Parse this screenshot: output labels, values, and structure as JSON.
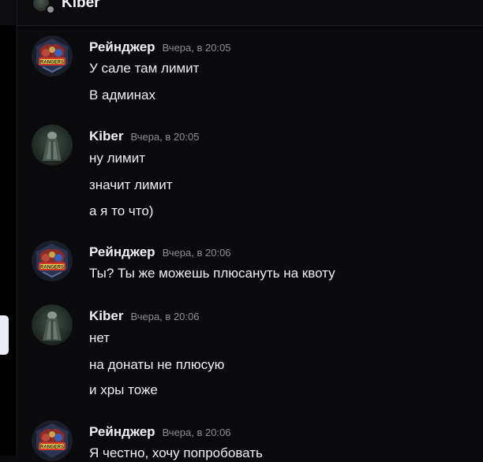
{
  "header": {
    "title": "Kiber",
    "avatar_icon": "user-avatar-icon",
    "status_icon": "status-dot-icon"
  },
  "colors": {
    "background": "#0a0a0c",
    "text": "#eef0f3",
    "timestamp": "#8b8e95",
    "side_pill": "#e9edf3"
  },
  "messages": [
    {
      "author": "Рейнджер",
      "timestamp": "Вчера, в 20:05",
      "avatar_icon": "rangers-logo-avatar",
      "lines": [
        "У сале там лимит",
        "В админах"
      ]
    },
    {
      "author": "Kiber",
      "timestamp": "Вчера, в 20:05",
      "avatar_icon": "dark-figure-avatar",
      "lines": [
        "ну лимит",
        "значит лимит",
        "а я то что)"
      ]
    },
    {
      "author": "Рейнджер",
      "timestamp": "Вчера, в 20:06",
      "avatar_icon": "rangers-logo-avatar",
      "lines": [
        "Ты? Ты же можешь плюсануть на квоту"
      ]
    },
    {
      "author": "Kiber",
      "timestamp": "Вчера, в 20:06",
      "avatar_icon": "dark-figure-avatar",
      "lines": [
        "нет",
        "на донаты не плюсую",
        "и хры тоже"
      ]
    },
    {
      "author": "Рейнджер",
      "timestamp": "Вчера, в 20:06",
      "avatar_icon": "rangers-logo-avatar",
      "lines": [
        "Я честно, хочу попробовать"
      ]
    }
  ]
}
